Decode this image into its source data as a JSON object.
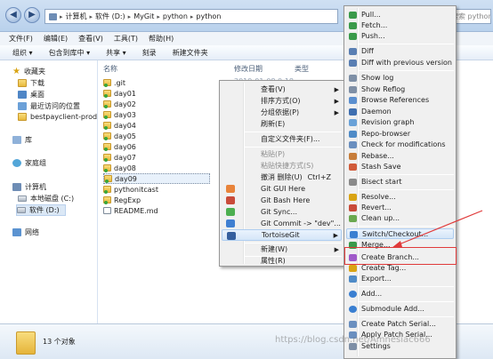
{
  "address": {
    "crumbs": [
      "计算机",
      "软件 (D:)",
      "MyGit",
      "python",
      "python"
    ],
    "search_placeholder": "搜索 python"
  },
  "menubar": [
    "文件(F)",
    "编辑(E)",
    "查看(V)",
    "工具(T)",
    "帮助(H)"
  ],
  "toolbar": [
    "组织 ▾",
    "包含到库中 ▾",
    "共享 ▾",
    "刻录",
    "新建文件夹"
  ],
  "navpane": {
    "favorites": "收藏夹",
    "downloads": "下载",
    "desktop": "桌面",
    "recent": "最近访问的位置",
    "pinned": "bestpayclient-prod",
    "libraries": "库",
    "homegroup": "家庭组",
    "computer": "计算机",
    "drive_c": "本地磁盘 (C:)",
    "drive_d": "软件 (D:)",
    "network": "网络"
  },
  "columns": {
    "name": "名称",
    "date": "修改日期",
    "type": "类型"
  },
  "files": [
    ".git",
    "day01",
    "day02",
    "day03",
    "day04",
    "day05",
    "day06",
    "day07",
    "day08",
    "day09",
    "pythonitcast",
    "RegExp",
    "README.md"
  ],
  "first_date": "2019-01-08 0:18",
  "status": {
    "count": "13 个对象"
  },
  "context_menu": {
    "view": "查看(V)",
    "sort": "排序方式(O)",
    "group": "分组依据(P)",
    "refresh": "刷新(E)",
    "customize": "自定义文件夹(F)...",
    "paste": "粘贴(P)",
    "paste_shortcut": "粘贴快捷方式(S)",
    "undo": "撤消 删除(U)",
    "undo_key": "Ctrl+Z",
    "git_gui": "Git GUI Here",
    "git_bash": "Git Bash Here",
    "git_sync": "Git Sync...",
    "git_commit": "Git Commit -> \"dev\"...",
    "tortoise": "TortoiseGit",
    "new": "新建(W)",
    "properties": "属性(R)"
  },
  "tortoise_menu": [
    "Pull...",
    "Fetch...",
    "Push...",
    "Diff",
    "Diff with previous version",
    "Show log",
    "Show Reflog",
    "Browse References",
    "Daemon",
    "Revision graph",
    "Repo-browser",
    "Check for modifications",
    "Rebase...",
    "Stash Save",
    "Bisect start",
    "Resolve...",
    "Revert...",
    "Clean up...",
    "Switch/Checkout...",
    "Merge...",
    "Create Branch...",
    "Create Tag...",
    "Export...",
    "Add...",
    "Submodule Add...",
    "Create Patch Serial...",
    "Apply Patch Serial...",
    "Settings"
  ],
  "colors": {
    "annotation": "#e03a3a",
    "menu_bg": "#f0f0f0"
  },
  "watermark": "https://blog.csdn.net/Amnesiac666"
}
